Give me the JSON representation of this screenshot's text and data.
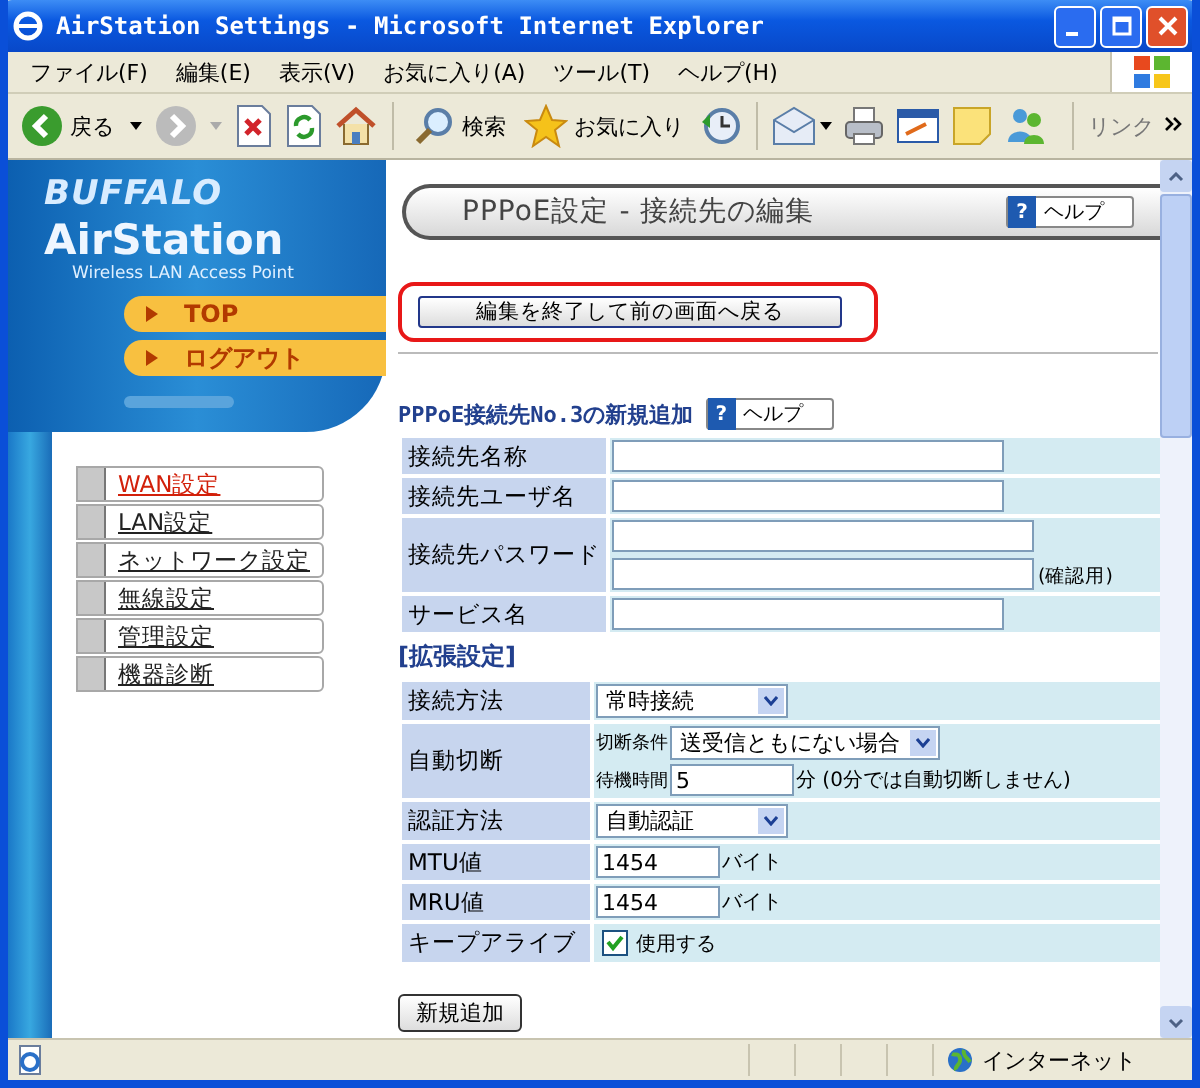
{
  "window": {
    "title": "AirStation Settings - Microsoft Internet Explorer"
  },
  "menu_bar": [
    "ファイル(F)",
    "編集(E)",
    "表示(V)",
    "お気に入り(A)",
    "ツール(T)",
    "ヘルプ(H)"
  ],
  "toolbar": {
    "back": "戻る",
    "search": "検索",
    "favorites": "お気に入り",
    "links": "リンク"
  },
  "sidebar": {
    "brand": "BUFFALO",
    "product": "AirStation",
    "tagline": "Wireless LAN Access Point",
    "quick_buttons": [
      "TOP",
      "ログアウト"
    ],
    "items": [
      {
        "label": "WAN設定",
        "selected": true
      },
      {
        "label": "LAN設定",
        "selected": false
      },
      {
        "label": "ネットワーク設定",
        "selected": false
      },
      {
        "label": "無線設定",
        "selected": false
      },
      {
        "label": "管理設定",
        "selected": false
      },
      {
        "label": "機器診断",
        "selected": false
      }
    ]
  },
  "header": {
    "title": "PPPoE設定 - 接続先の編集",
    "help_icon": "?",
    "help": "ヘルプ"
  },
  "back_button": "編集を終了して前の画面へ戻る",
  "section": {
    "title": "PPPoE接続先No.3の新規追加",
    "help_icon": "?",
    "help": "ヘルプ"
  },
  "basic_rows": [
    {
      "kind": "text",
      "label": "接続先名称"
    },
    {
      "kind": "text",
      "label": "接続先ユーザ名"
    },
    {
      "kind": "password",
      "label": "接続先パスワード",
      "note": "(確認用)"
    },
    {
      "kind": "text",
      "label": "サービス名"
    }
  ],
  "extended_title": "[拡張設定]",
  "extended_rows": [
    {
      "kind": "select",
      "label": "接続方法",
      "value": "常時接続"
    },
    {
      "kind": "auto",
      "label": "自動切断",
      "condition_label": "切断条件",
      "condition_value": "送受信ともにない場合",
      "wait_label": "待機時間",
      "wait_value": "5",
      "wait_note": "分 (0分では自動切断しません)"
    },
    {
      "kind": "select",
      "label": "認証方法",
      "value": "自動認証"
    },
    {
      "kind": "number",
      "label": "MTU値",
      "value": "1454",
      "unit": "バイト"
    },
    {
      "kind": "number",
      "label": "MRU値",
      "value": "1454",
      "unit": "バイト"
    },
    {
      "kind": "checkbox",
      "label": "キープアライブ",
      "checked": true,
      "option": "使用する"
    }
  ],
  "submit_button": "新規追加",
  "status_bar": {
    "zone": "インターネット"
  }
}
